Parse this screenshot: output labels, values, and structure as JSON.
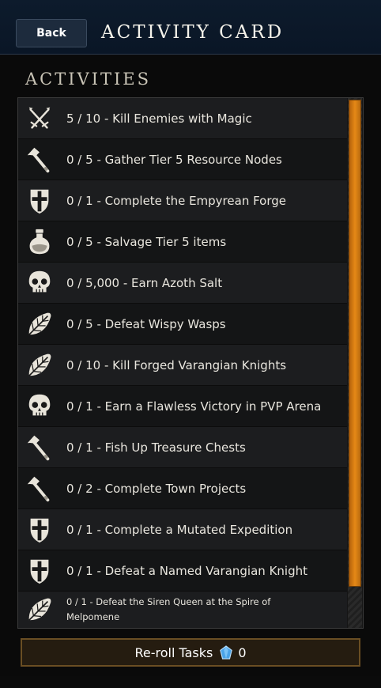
{
  "header": {
    "back_label": "Back",
    "title": "ACTIVITY CARD"
  },
  "section": {
    "title": "ACTIVITIES"
  },
  "activities": [
    {
      "text": "5 / 10 - Kill Enemies with Magic",
      "icon": "crossed-swords-icon"
    },
    {
      "text": "0 / 5 - Gather Tier 5 Resource Nodes",
      "icon": "axe-icon"
    },
    {
      "text": "0 / 1 - Complete the Empyrean Forge",
      "icon": "shield-cross-icon"
    },
    {
      "text": "0 / 5 - Salvage Tier 5 items",
      "icon": "potion-flask-icon"
    },
    {
      "text": "0 / 5,000 - Earn Azoth Salt",
      "icon": "skull-icon"
    },
    {
      "text": "0 / 5 - Defeat Wispy Wasps",
      "icon": "leaf-icon"
    },
    {
      "text": "0 / 10 - Kill Forged Varangian Knights",
      "icon": "leaf-icon"
    },
    {
      "text": "0 / 1 - Earn a Flawless Victory in PVP Arena",
      "icon": "skull-icon"
    },
    {
      "text": "0 / 1 - Fish Up Treasure Chests",
      "icon": "axe-icon"
    },
    {
      "text": "0 / 2 - Complete Town Projects",
      "icon": "axe-icon"
    },
    {
      "text": "0 / 1 - Complete a Mutated Expedition",
      "icon": "shield-cross-icon"
    },
    {
      "text": "0 / 1 - Defeat a Named Varangian Knight",
      "icon": "shield-cross-icon"
    },
    {
      "text": "0 / 1 - Defeat the Siren Queen at the Spire of Melpomene",
      "icon": "leaf-icon"
    }
  ],
  "footer": {
    "reroll_label": "Re-roll Tasks",
    "reroll_cost": "0",
    "cost_icon": "azoth-gem-icon"
  },
  "colors": {
    "header_bg": "#0d1b2c",
    "scroll_thumb": "#e58916",
    "row_odd": "#1c1d1f",
    "row_even": "#141516"
  }
}
